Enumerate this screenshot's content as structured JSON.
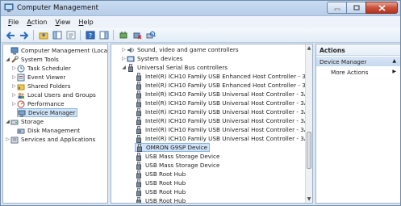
{
  "window": {
    "title": "Computer Management"
  },
  "menu": [
    {
      "accel": "F",
      "rest": "ile"
    },
    {
      "accel": "A",
      "rest": "ction"
    },
    {
      "accel": "V",
      "rest": "iew"
    },
    {
      "accel": "H",
      "rest": "elp"
    }
  ],
  "left_tree": [
    {
      "label": "Computer Management (Local)",
      "icon": "computer-icon",
      "exp": ""
    },
    {
      "label": "System Tools",
      "icon": "tools-icon",
      "exp": "◢"
    },
    {
      "label": "Task Scheduler",
      "icon": "clock-icon",
      "exp": "▷"
    },
    {
      "label": "Event Viewer",
      "icon": "event-viewer-icon",
      "exp": "▷"
    },
    {
      "label": "Shared Folders",
      "icon": "folder-share-icon",
      "exp": "▷"
    },
    {
      "label": "Local Users and Groups",
      "icon": "users-icon",
      "exp": "▷"
    },
    {
      "label": "Performance",
      "icon": "performance-icon",
      "exp": "▷"
    },
    {
      "label": "Device Manager",
      "icon": "device-manager-icon",
      "exp": ""
    },
    {
      "label": "Storage",
      "icon": "storage-icon",
      "exp": "◢"
    },
    {
      "label": "Disk Management",
      "icon": "disk-icon",
      "exp": ""
    },
    {
      "label": "Services and Applications",
      "icon": "services-icon",
      "exp": "▷"
    }
  ],
  "device_tree": [
    {
      "label": "Sound, video and game controllers",
      "icon": "sound-icon",
      "exp": "▷"
    },
    {
      "label": "System devices",
      "icon": "system-devices-icon",
      "exp": "▷"
    },
    {
      "label": "Universal Serial Bus controllers",
      "icon": "usb-controller-icon",
      "exp": "◢"
    },
    {
      "label": "Intel(R) ICH10 Family USB Enhanced Host Controller - 3A3A",
      "icon": "usb-device-icon",
      "exp": ""
    },
    {
      "label": "Intel(R) ICH10 Family USB Enhanced Host Controller - 3A3C",
      "icon": "usb-device-icon",
      "exp": ""
    },
    {
      "label": "Intel(R) ICH10 Family USB Universal Host Controller - 3A34",
      "icon": "usb-device-icon",
      "exp": ""
    },
    {
      "label": "Intel(R) ICH10 Family USB Universal Host Controller - 3A35",
      "icon": "usb-device-icon",
      "exp": ""
    },
    {
      "label": "Intel(R) ICH10 Family USB Universal Host Controller - 3A36",
      "icon": "usb-device-icon",
      "exp": ""
    },
    {
      "label": "Intel(R) ICH10 Family USB Universal Host Controller - 3A37",
      "icon": "usb-device-icon",
      "exp": ""
    },
    {
      "label": "Intel(R) ICH10 Family USB Universal Host Controller - 3A38",
      "icon": "usb-device-icon",
      "exp": ""
    },
    {
      "label": "Intel(R) ICH10 Family USB Universal Host Controller - 3A39",
      "icon": "usb-device-icon",
      "exp": ""
    },
    {
      "label": "OMRON G9SP Device",
      "icon": "usb-device-icon",
      "exp": ""
    },
    {
      "label": "USB Mass Storage Device",
      "icon": "usb-device-icon",
      "exp": ""
    },
    {
      "label": "USB Mass Storage Device",
      "icon": "usb-device-icon",
      "exp": ""
    },
    {
      "label": "USB Root Hub",
      "icon": "usb-device-icon",
      "exp": ""
    },
    {
      "label": "USB Root Hub",
      "icon": "usb-device-icon",
      "exp": ""
    },
    {
      "label": "USB Root Hub",
      "icon": "usb-device-icon",
      "exp": ""
    },
    {
      "label": "USB Root Hub",
      "icon": "usb-device-icon",
      "exp": ""
    },
    {
      "label": "USB Root Hub",
      "icon": "usb-device-icon",
      "exp": ""
    }
  ],
  "selected_left": "Device Manager",
  "selected_device": "OMRON G9SP Device",
  "actions": {
    "header": "Actions",
    "section": "Device Manager",
    "more": "More Actions"
  },
  "colors": {
    "accent": "#cfe2f7",
    "title_bar": "#b6cde9",
    "close_button": "#c9523c"
  }
}
